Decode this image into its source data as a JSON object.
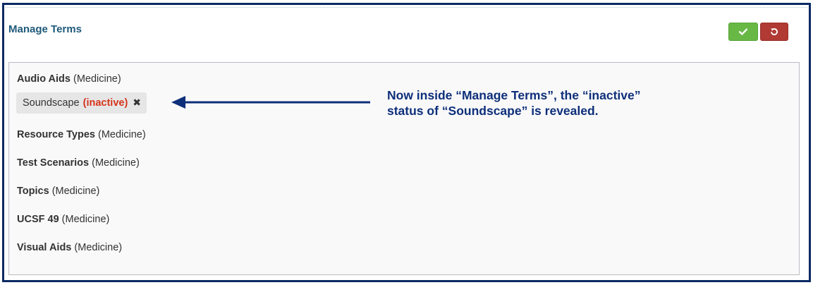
{
  "panel": {
    "title": "Manage Terms",
    "save_icon": "check-icon",
    "reset_icon": "undo-icon"
  },
  "terms": [
    {
      "name": "Audio Aids",
      "scope": "(Medicine)"
    },
    {
      "name": "Resource Types",
      "scope": "(Medicine)"
    },
    {
      "name": "Test Scenarios",
      "scope": "(Medicine)"
    },
    {
      "name": "Topics",
      "scope": "(Medicine)"
    },
    {
      "name": "UCSF 49",
      "scope": "(Medicine)"
    },
    {
      "name": "Visual Aids",
      "scope": "(Medicine)"
    }
  ],
  "selected_chip": {
    "label": "Soundscape",
    "status": "(inactive)",
    "remove_icon": "close-icon"
  },
  "annotation": {
    "line1": "Now inside “Manage Terms”, the “inactive”",
    "line2": "status of “Soundscape” is revealed."
  },
  "colors": {
    "frame": "#0b2a63",
    "title": "#1f5a7a",
    "save_button": "#68b845",
    "reset_button": "#b13a34",
    "inactive": "#d6341c",
    "annotation": "#0e2f7a"
  }
}
